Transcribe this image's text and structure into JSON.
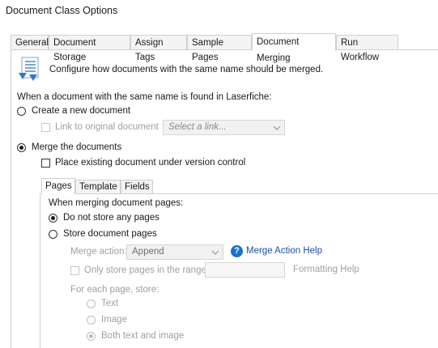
{
  "window": {
    "title": "Document Class Options"
  },
  "tabs": [
    {
      "label": "General"
    },
    {
      "label": "Document Storage"
    },
    {
      "label": "Assign Tags"
    },
    {
      "label": "Sample Pages"
    },
    {
      "label": "Document Merging",
      "active": true
    },
    {
      "label": "Run Workflow"
    }
  ],
  "header": {
    "description": "Configure how documents with the same name should be merged.",
    "icon": "merge-document-icon"
  },
  "found_prompt": "When a document with the same name is found in Laserfiche:",
  "create_new": {
    "label": "Create a new document",
    "selected": false
  },
  "link_original": {
    "label": "Link to original document",
    "checked": false,
    "placeholder": "Select a link..."
  },
  "merge": {
    "label": "Merge the documents",
    "selected": true
  },
  "version_control": {
    "label": "Place existing document under version control",
    "checked": false
  },
  "inner_tabs": [
    {
      "label": "Pages",
      "active": true
    },
    {
      "label": "Template"
    },
    {
      "label": "Fields"
    }
  ],
  "pages": {
    "prompt": "When merging document pages:",
    "no_store": {
      "label": "Do not store any pages",
      "selected": true
    },
    "store": {
      "label": "Store document pages",
      "selected": false
    },
    "merge_action_label": "Merge action:",
    "merge_action_value": "Append",
    "help_link": "Merge Action Help",
    "range_label": "Only store pages in the range:",
    "formatting_help": "Formatting Help",
    "for_each_label": "For each page, store:",
    "options": [
      {
        "label": "Text",
        "selected": false
      },
      {
        "label": "Image",
        "selected": false
      },
      {
        "label": "Both text and image",
        "selected": true
      }
    ]
  },
  "colors": {
    "accent": "#1a6fd0",
    "link": "#1a4fa8",
    "border": "#d0d0d0"
  }
}
